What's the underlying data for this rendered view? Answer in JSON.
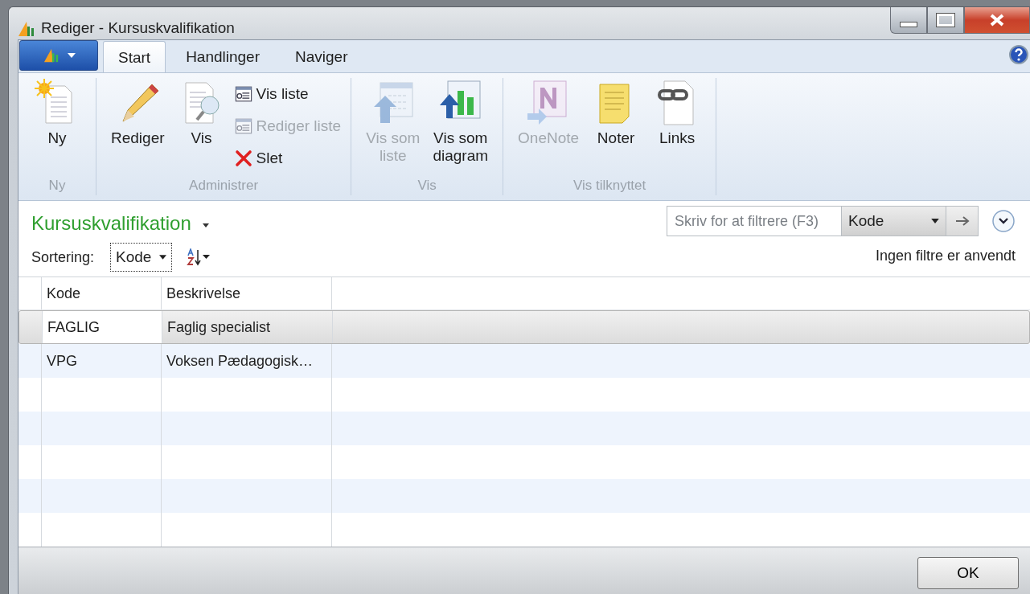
{
  "window": {
    "title": "Rediger - Kursuskvalifikation"
  },
  "ribbon": {
    "tabs": [
      {
        "label": "Start",
        "selected": true
      },
      {
        "label": "Handlinger",
        "selected": false
      },
      {
        "label": "Naviger",
        "selected": false
      }
    ],
    "groups": [
      {
        "label": "Ny",
        "items": [
          {
            "kind": "large",
            "label": "Ny",
            "disabled": false
          }
        ]
      },
      {
        "label": "Administrer",
        "items": [
          {
            "kind": "large",
            "label": "Rediger",
            "disabled": false
          },
          {
            "kind": "large",
            "label": "Vis",
            "disabled": false
          },
          {
            "kind": "small",
            "label": "Vis liste",
            "disabled": false
          },
          {
            "kind": "small",
            "label": "Rediger liste",
            "disabled": true
          },
          {
            "kind": "small",
            "label": "Slet",
            "disabled": false
          }
        ]
      },
      {
        "label": "Vis",
        "items": [
          {
            "kind": "large",
            "label": "Vis som\nliste",
            "disabled": true
          },
          {
            "kind": "large",
            "label": "Vis som\ndiagram",
            "disabled": false
          }
        ]
      },
      {
        "label": "Vis tilknyttet",
        "items": [
          {
            "kind": "large",
            "label": "OneNote",
            "disabled": true
          },
          {
            "kind": "large",
            "label": "Noter",
            "disabled": false
          },
          {
            "kind": "large",
            "label": "Links",
            "disabled": false
          }
        ]
      }
    ]
  },
  "page": {
    "title": "Kursuskvalifikation",
    "filter": {
      "placeholder": "Skriv for at filtrere (F3)",
      "field": "Kode"
    },
    "sort": {
      "label": "Sortering:",
      "value": "Kode"
    },
    "filter_status": "Ingen filtre er anvendt"
  },
  "table": {
    "columns": [
      "Kode",
      "Beskrivelse"
    ],
    "rows": [
      {
        "cells": [
          "FAGLIG",
          "Faglig specialist"
        ],
        "selected": true
      },
      {
        "cells": [
          "VPG",
          "Voksen Pædagogisk…"
        ],
        "selected": false
      }
    ]
  },
  "buttons": [
    "OK"
  ]
}
